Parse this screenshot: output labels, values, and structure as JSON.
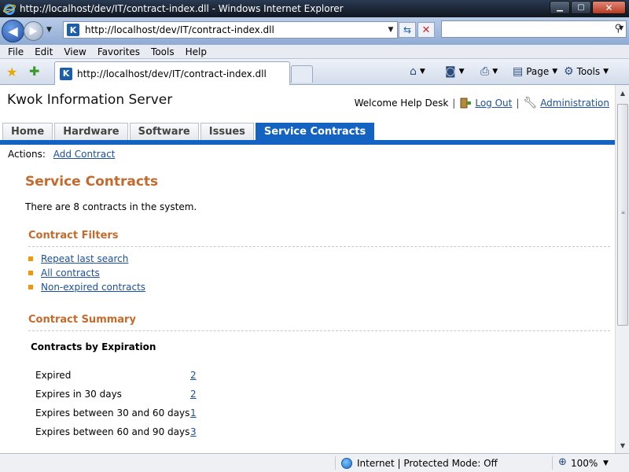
{
  "window": {
    "title": "http://localhost/dev/IT/contract-index.dll - Windows Internet Explorer",
    "min_glyph": "▁",
    "max_glyph": "▢",
    "close_glyph": "✕"
  },
  "address": {
    "url": "http://localhost/dev/IT/contract-index.dll",
    "site_icon_letter": "K",
    "search_placeholder": ""
  },
  "menu": [
    "File",
    "Edit",
    "View",
    "Favorites",
    "Tools",
    "Help"
  ],
  "browser_tab": {
    "title": "http://localhost/dev/IT/contract-index.dll"
  },
  "commands": {
    "page": "Page",
    "tools": "Tools"
  },
  "site": {
    "title": "Kwok Information Server",
    "welcome": "Welcome Help Desk",
    "logout": "Log Out",
    "administration": "Administration"
  },
  "tabs": [
    {
      "label": "Home"
    },
    {
      "label": "Hardware"
    },
    {
      "label": "Software"
    },
    {
      "label": "Issues"
    },
    {
      "label": "Service Contracts",
      "active": true
    }
  ],
  "actions": {
    "label": "Actions:",
    "add_contract": "Add Contract"
  },
  "main": {
    "heading": "Service Contracts",
    "count_text": "There are 8 contracts in the system."
  },
  "filters": {
    "heading": "Contract Filters",
    "items": [
      "Repeat last search",
      "All contracts",
      "Non-expired contracts"
    ]
  },
  "summary": {
    "heading": "Contract Summary",
    "subheading": "Contracts by Expiration",
    "rows": [
      {
        "label": "Expired",
        "value": "2"
      },
      {
        "label": "Expires in 30 days",
        "value": "2"
      },
      {
        "label": "Expires between 30 and 60 days",
        "value": "1"
      },
      {
        "label": "Expires between 60 and 90 days",
        "value": "3"
      }
    ]
  },
  "status": {
    "zone": "Internet | Protected Mode: Off",
    "zoom": "100%"
  },
  "colors": {
    "accent_blue": "#1463c3",
    "heading_orange": "#c46a2c",
    "bullet_orange": "#e89a14",
    "link_blue": "#1b4f9c"
  }
}
